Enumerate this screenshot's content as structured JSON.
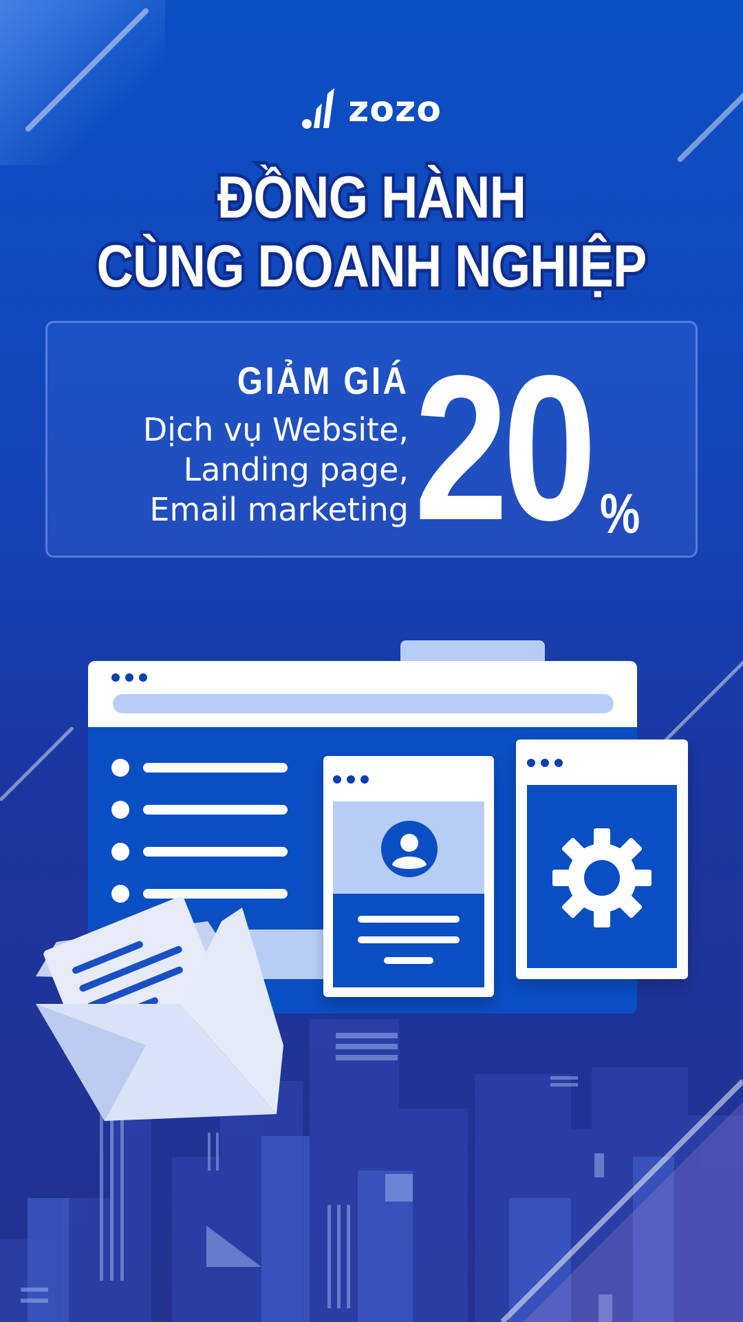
{
  "brand": {
    "logo_text": "zozo"
  },
  "headline": {
    "line1": "ĐỒNG HÀNH",
    "line2": "CÙNG DOANH NGHIỆP"
  },
  "promo": {
    "discount_label": "GIẢM GIÁ",
    "services": [
      "Dịch vụ Website,",
      "Landing page,",
      "Email marketing"
    ],
    "percent_value": "20",
    "percent_sign": "%"
  },
  "illustration": {
    "icons": [
      "browser-window",
      "user-profile-icon",
      "gear-icon",
      "envelope-icon",
      "city-skyline"
    ]
  },
  "colors": {
    "background_top": "#0a4fc4",
    "background_bottom": "#25318f",
    "accent_light": "#b7cdf5",
    "headline_stroke": "#0f2d8f",
    "text": "#ffffff"
  }
}
